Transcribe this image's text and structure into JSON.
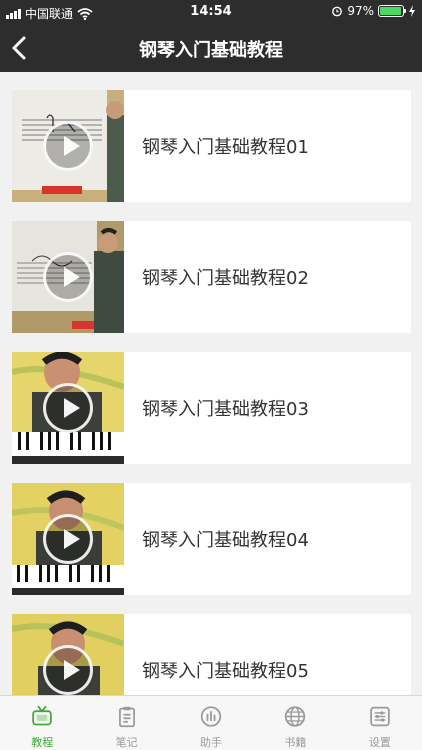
{
  "status": {
    "carrier": "中国联通",
    "time": "14:54",
    "battery": "97%",
    "battery_level": 0.97
  },
  "nav": {
    "title": "钢琴入门基础教程",
    "back_icon": "back-chevron-icon"
  },
  "lessons": [
    {
      "title": "钢琴入门基础教程01",
      "thumb": "whiteboard"
    },
    {
      "title": "钢琴入门基础教程02",
      "thumb": "whiteboard"
    },
    {
      "title": "钢琴入门基础教程03",
      "thumb": "piano-teacher"
    },
    {
      "title": "钢琴入门基础教程04",
      "thumb": "piano-teacher"
    },
    {
      "title": "钢琴入门基础教程05",
      "thumb": "piano-teacher"
    }
  ],
  "tabs": [
    {
      "label": "教程",
      "icon": "tv-icon",
      "active": true
    },
    {
      "label": "笔记",
      "icon": "clipboard-icon",
      "active": false
    },
    {
      "label": "助手",
      "icon": "bars-circle-icon",
      "active": false
    },
    {
      "label": "书籍",
      "icon": "globe-icon",
      "active": false
    },
    {
      "label": "设置",
      "icon": "sliders-icon",
      "active": false
    }
  ],
  "colors": {
    "bar_bg": "#2d2d2d",
    "accent": "#42a83a",
    "tab_inactive": "#9a9a9a"
  }
}
